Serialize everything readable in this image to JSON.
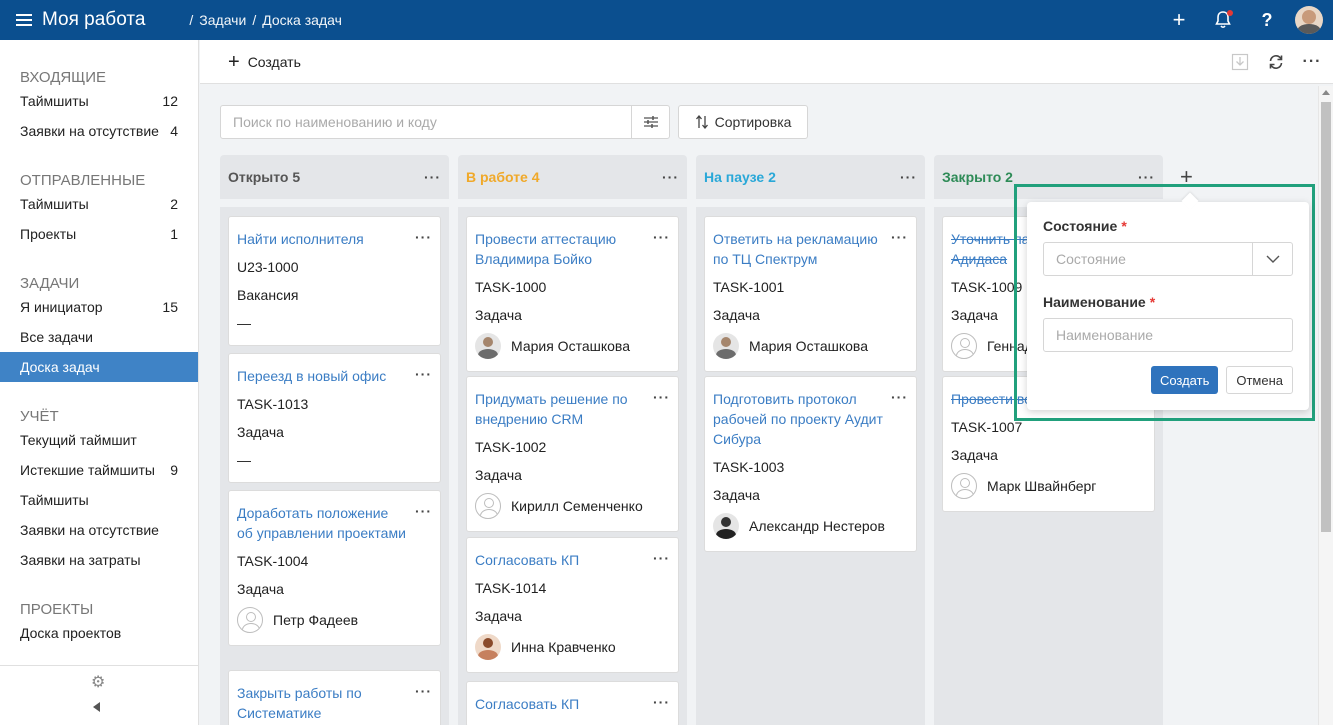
{
  "header": {
    "app_title": "Моя работа",
    "breadcrumb": [
      "Задачи",
      "/",
      "Доска задач"
    ],
    "slash_prefix": "/"
  },
  "sidebar": {
    "sections": [
      {
        "title": "ВХОДЯЩИЕ",
        "items": [
          {
            "label": "Таймшиты",
            "count": "12"
          },
          {
            "label": "Заявки на отсутствие",
            "count": "4"
          }
        ]
      },
      {
        "title": "ОТПРАВЛЕННЫЕ",
        "items": [
          {
            "label": "Таймшиты",
            "count": "2"
          },
          {
            "label": "Проекты",
            "count": "1"
          }
        ]
      },
      {
        "title": "ЗАДАЧИ",
        "items": [
          {
            "label": "Я инициатор",
            "count": "15"
          },
          {
            "label": "Все задачи",
            "count": ""
          },
          {
            "label": "Доска задач",
            "count": "",
            "active": true
          }
        ]
      },
      {
        "title": "УЧЁТ",
        "items": [
          {
            "label": "Текущий таймшит",
            "count": ""
          },
          {
            "label": "Истекшие таймшиты",
            "count": "9"
          },
          {
            "label": "Таймшиты",
            "count": ""
          },
          {
            "label": "Заявки на отсутствие",
            "count": ""
          },
          {
            "label": "Заявки на затраты",
            "count": ""
          }
        ]
      },
      {
        "title": "ПРОЕКТЫ",
        "items": [
          {
            "label": "Доска проектов",
            "count": ""
          }
        ]
      }
    ]
  },
  "toolbar": {
    "create_label": "Создать"
  },
  "search": {
    "placeholder": "Поиск по наименованию и коду"
  },
  "sort": {
    "label": "Сортировка"
  },
  "columns": [
    {
      "title": "Открыто 5",
      "color": "#555555",
      "cards": [
        {
          "title": "Найти исполнителя",
          "code": "U23-1000",
          "type": "Вакансия",
          "person": "—",
          "avatar": "none"
        },
        {
          "title": "Переезд в новый офис",
          "code": "TASK-1013",
          "type": "Задача",
          "person": "—",
          "avatar": "none"
        },
        {
          "title": "Доработать положение об управлении проектами",
          "code": "TASK-1004",
          "type": "Задача",
          "person": "Петр Фадеев",
          "avatar": "placeholder"
        },
        {
          "title": "Закрыть работы по Систематике",
          "code": "",
          "type": "",
          "person": "",
          "avatar": "none"
        }
      ]
    },
    {
      "title": "В работе 4",
      "color": "#f0a92a",
      "cards": [
        {
          "title": "Провести аттестацию Владимира Бойко",
          "code": "TASK-1000",
          "type": "Задача",
          "person": "Мария Осташкова",
          "avatar": "photo"
        },
        {
          "title": "Придумать решение по внедрению CRM",
          "code": "TASK-1002",
          "type": "Задача",
          "person": "Кирилл Семенченко",
          "avatar": "placeholder"
        },
        {
          "title": "Согласовать КП",
          "code": "TASK-1014",
          "type": "Задача",
          "person": "Инна Кравченко",
          "avatar": "photo3"
        },
        {
          "title": "Согласовать КП",
          "code": "",
          "type": "",
          "person": "",
          "avatar": "none"
        }
      ]
    },
    {
      "title": "На паузе 2",
      "color": "#29a8d8",
      "cards": [
        {
          "title": "Ответить на рекламацию по ТЦ Спектрум",
          "code": "TASK-1001",
          "type": "Задача",
          "person": "Мария Осташкова",
          "avatar": "photo"
        },
        {
          "title": "Подготовить протокол рабочей по проекту Аудит Сибура",
          "code": "TASK-1003",
          "type": "Задача",
          "person": "Александр Нестеров",
          "avatar": "photo2"
        }
      ]
    },
    {
      "title": "Закрыто 2",
      "color": "#2e8b57",
      "cards": [
        {
          "title": "Уточнить па... для Адидаса",
          "code": "TASK-1009",
          "type": "Задача",
          "person": "Геннад...",
          "avatar": "placeholder",
          "strike": true
        },
        {
          "title": "Провести во... клиентом",
          "code": "TASK-1007",
          "type": "Задача",
          "person": "Марк Швайнберг",
          "avatar": "placeholder",
          "strike": true
        }
      ]
    }
  ],
  "popover": {
    "state_label": "Состояние",
    "state_placeholder": "Состояние",
    "name_label": "Наименование",
    "name_placeholder": "Наименование",
    "required_mark": "*",
    "create_button": "Создать",
    "cancel_button": "Отмена"
  },
  "colors": {
    "topbar": "#0b4f8f",
    "active_nav": "#3f83c6",
    "link": "#3b7dc4",
    "highlight_frame": "#21a07c"
  }
}
